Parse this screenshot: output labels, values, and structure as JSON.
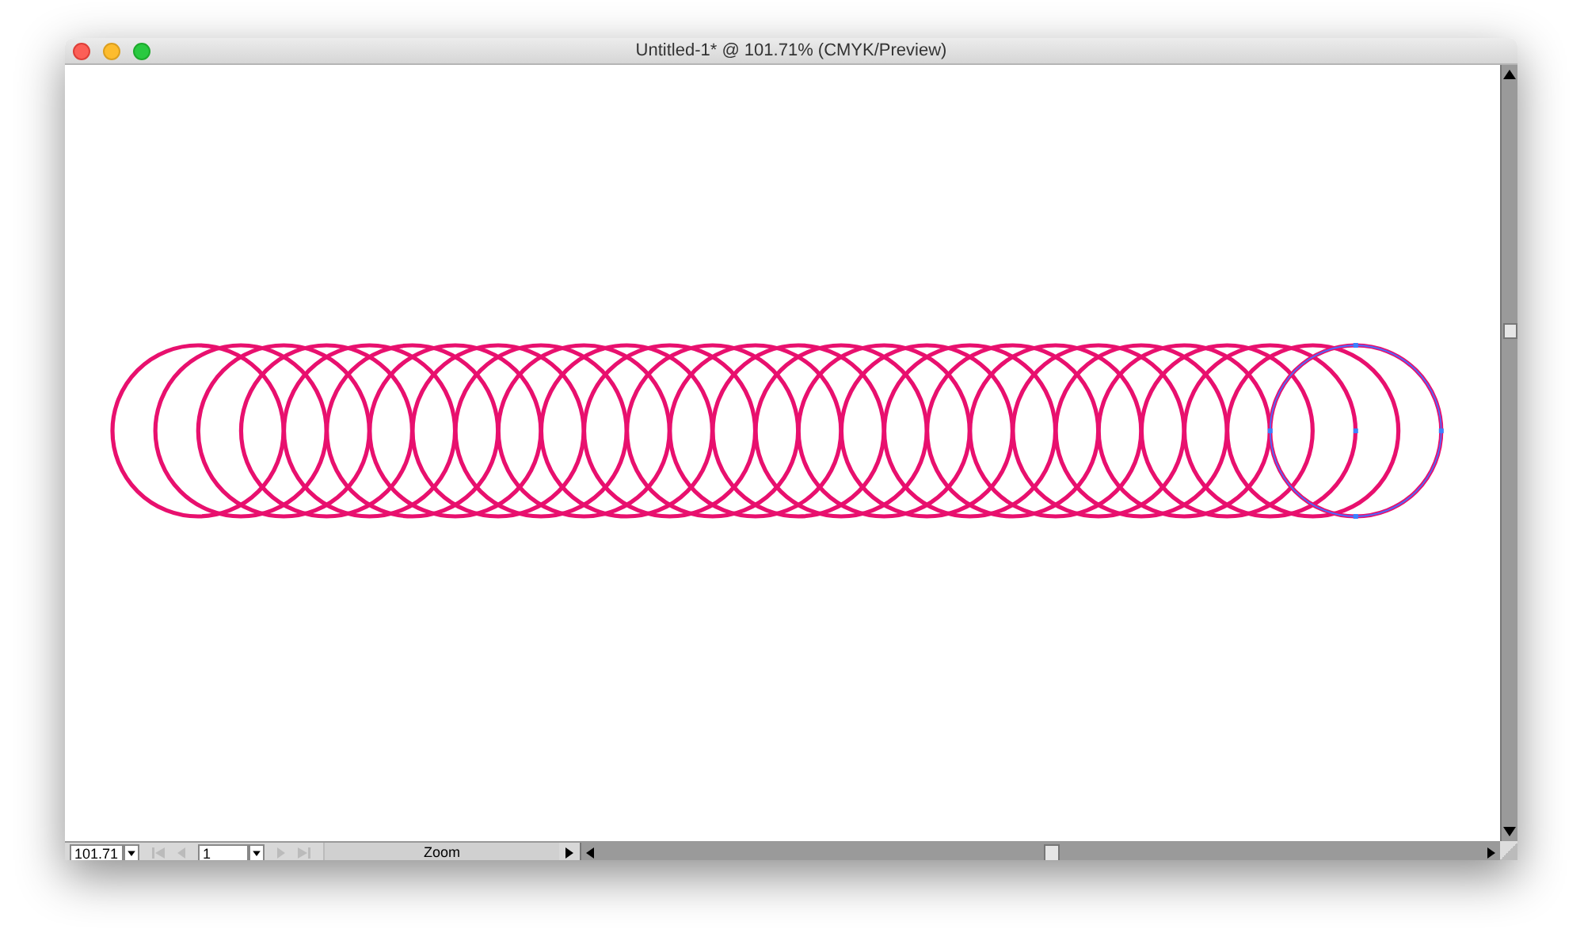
{
  "window": {
    "title": "Untitled-1* @ 101.71% (CMYK/Preview)"
  },
  "artwork": {
    "kind": "circle-blend",
    "selected": true
  },
  "status_bar": {
    "zoom": "101.71",
    "page": "1",
    "status": "Zoom"
  }
}
